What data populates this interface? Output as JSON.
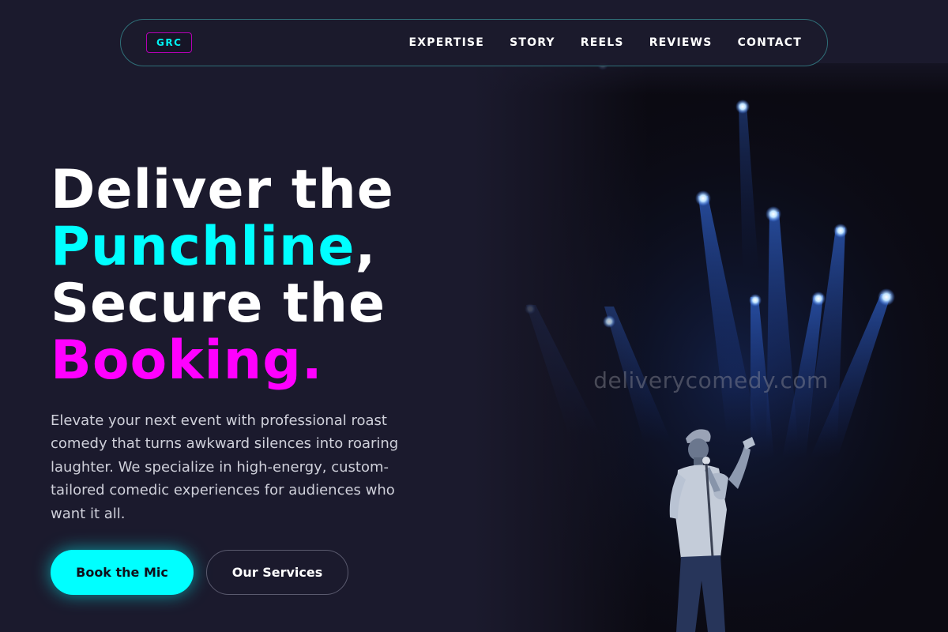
{
  "brand": {
    "logo": "GRC"
  },
  "nav": {
    "items": [
      "EXPERTISE",
      "STORY",
      "REELS",
      "REVIEWS",
      "CONTACT"
    ]
  },
  "hero": {
    "line1": "Deliver the",
    "line2_highlight": "Punchline",
    "line2_suffix": ",",
    "line3": "Secure the",
    "line4_highlight": "Booking.",
    "body": "Elevate your next event with professional roast comedy that turns awkward silences into roaring laughter. We specialize in high-energy, custom-tailored comedic experiences for audiences who want it all.",
    "primary_button": "Book the Mic",
    "secondary_button": "Our Services"
  },
  "image": {
    "watermark": "deliverycomedy.com"
  },
  "colors": {
    "background": "#1b1a2d",
    "accent_cyan": "#00ffff",
    "accent_magenta": "#ff00ff"
  }
}
